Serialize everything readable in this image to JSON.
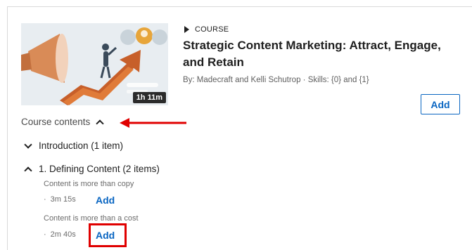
{
  "course": {
    "type_label": "COURSE",
    "title": "Strategic Content Marketing: Attract, Engage, and Retain",
    "byline": "By: Madecraft and Kelli Schutrop  ·  Skills: {0} and {1}",
    "duration": "1h 11m",
    "add_label": "Add"
  },
  "contents": {
    "header_label": "Course contents",
    "sections": [
      {
        "label": "Introduction (1 item)",
        "expanded": false
      },
      {
        "label": "1. Defining Content (2 items)",
        "expanded": true,
        "items": [
          {
            "title": "Content is more than copy",
            "duration": "3m 15s",
            "add_label": "Add"
          },
          {
            "title": "Content is more than a cost",
            "duration": "2m 40s",
            "add_label": "Add"
          }
        ]
      }
    ]
  },
  "colors": {
    "accent": "#0a66c2",
    "annotation": "#e00000",
    "thumbnail_orange": "#e07b39"
  }
}
